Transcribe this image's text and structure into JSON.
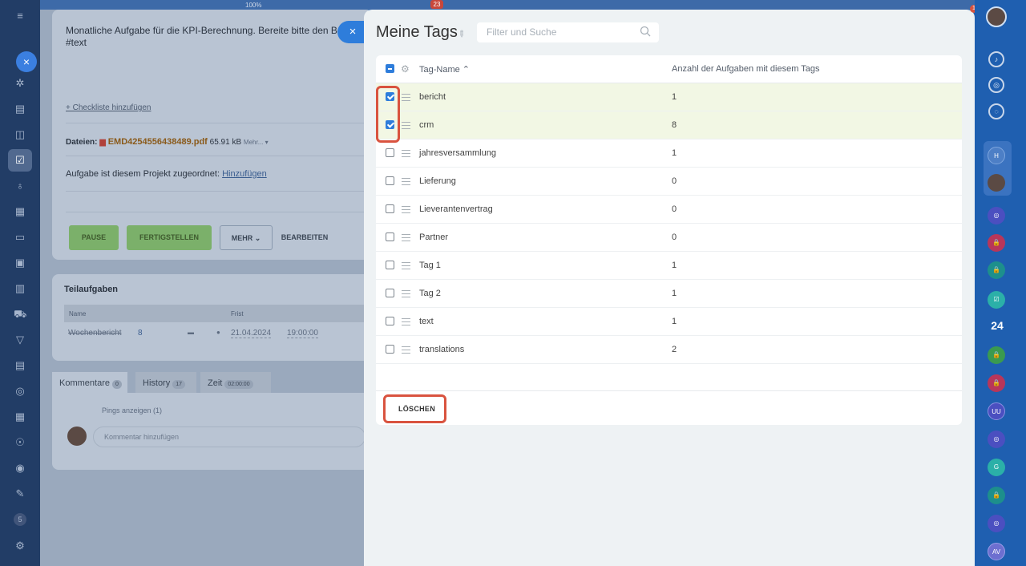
{
  "top_strip": {
    "zoom": "100%",
    "badge": "23"
  },
  "right_badge": "1",
  "task": {
    "description_line1": "Monatliche Aufgabe für die KPI-Berechnung. Bereite bitte den Bericht",
    "description_line2": "#text",
    "checklist_link": "+ Checkliste hinzufügen",
    "files_label": "Dateien:",
    "file_name": "EMD4254556438489.pdf",
    "file_size": "65.91 kB",
    "file_more": "Mehr... ▾",
    "project_text": "Aufgabe ist diesem Projekt zugeordnet:",
    "project_link": "Hinzufügen",
    "btn_pause": "PAUSE",
    "btn_finish": "FERTIGSTELLEN",
    "btn_more": "MEHR",
    "btn_edit": "BEARBEITEN",
    "subtasks_title": "Teilaufgaben",
    "subtasks_col_name": "Name",
    "subtasks_col_deadline": "Frist",
    "subtask_name": "Wochenbericht",
    "subtask_count": "8",
    "subtask_date": "21.04.2024",
    "subtask_time": "19:00:00",
    "tab_comments": "Kommentare",
    "tab_comments_count": "0",
    "tab_history": "History",
    "tab_history_count": "17",
    "tab_time": "Zeit",
    "tab_time_count": "02:00:00",
    "pings": "Pings anzeigen (1)",
    "comment_placeholder": "Kommentar hinzufügen"
  },
  "panel": {
    "title": "Meine Tags",
    "search_placeholder": "Filter und Suche",
    "col_name": "Tag-Name ⌃",
    "col_count": "Anzahl der Aufgaben mit diesem Tags",
    "rows": [
      {
        "name": "bericht",
        "count": "1",
        "checked": true
      },
      {
        "name": "crm",
        "count": "8",
        "checked": true
      },
      {
        "name": "jahresversammlung",
        "count": "1",
        "checked": false
      },
      {
        "name": "Lieferung",
        "count": "0",
        "checked": false
      },
      {
        "name": "Lieverantenvertrag",
        "count": "0",
        "checked": false
      },
      {
        "name": "Partner",
        "count": "0",
        "checked": false
      },
      {
        "name": "Tag 1",
        "count": "1",
        "checked": false
      },
      {
        "name": "Tag 2",
        "count": "1",
        "checked": false
      },
      {
        "name": "text",
        "count": "1",
        "checked": false
      },
      {
        "name": "translations",
        "count": "2",
        "checked": false
      }
    ],
    "delete_label": "LÖSCHEN"
  },
  "right_bar": {
    "counter": "24",
    "avatar_h": "H",
    "avatar_g": "G",
    "avatar_av": "AV",
    "avatar_uu": "UU"
  },
  "left_bar": {
    "counter": "5"
  },
  "colors": {
    "accent": "#2e7ddb",
    "highlight": "#d9533f",
    "selected_row": "#f2f7e4"
  }
}
